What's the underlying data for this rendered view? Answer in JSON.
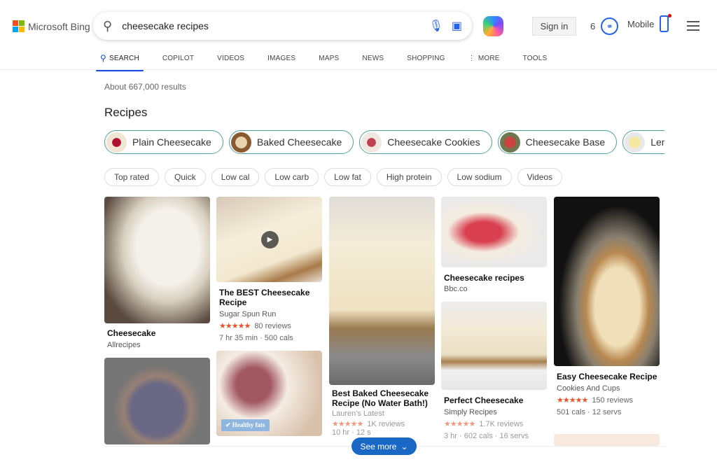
{
  "header": {
    "logo": "Microsoft Bing",
    "query": "cheesecake recipes",
    "sign_in": "Sign in",
    "rewards_count": "6",
    "mobile": "Mobile"
  },
  "tabs": [
    {
      "label": "SEARCH",
      "active": true
    },
    {
      "label": "COPILOT"
    },
    {
      "label": "VIDEOS"
    },
    {
      "label": "IMAGES"
    },
    {
      "label": "MAPS"
    },
    {
      "label": "NEWS"
    },
    {
      "label": "SHOPPING"
    },
    {
      "label": "MORE"
    },
    {
      "label": "TOOLS"
    }
  ],
  "results_count": "About 667,000 results",
  "section_title": "Recipes",
  "chips": [
    "Plain Cheesecake",
    "Baked Cheesecake",
    "Cheesecake Cookies",
    "Cheesecake Base",
    "Lemon Cheesecake"
  ],
  "filters": [
    "Top rated",
    "Quick",
    "Low cal",
    "Low carb",
    "Low fat",
    "High protein",
    "Low sodium",
    "Videos"
  ],
  "cards": [
    {
      "title": "Cheesecake",
      "source": "Allrecipes"
    },
    {
      "title": "The BEST Cheesecake Recipe",
      "source": "Sugar Spun Run",
      "stars": "★★★★★",
      "reviews": "80 reviews",
      "meta": "7 hr 35 min · 500 cals",
      "video": true
    },
    {
      "title": "Best Baked Cheesecake Recipe (No Water Bath!)",
      "source": "Lauren's Latest",
      "stars": "★★★★★",
      "reviews": "1K reviews",
      "meta": "10 hr · 12 s"
    },
    {
      "title": "Cheesecake recipes",
      "source": "Bbc.co"
    },
    {
      "title": "Perfect Cheesecake",
      "source": "Simply Recipes",
      "stars": "★★★★★",
      "reviews": "1.7K reviews",
      "meta": "3 hr · 602 cals · 16 servs"
    },
    {
      "title": "Easy Cheesecake Recipe",
      "source": "Cookies And Cups",
      "stars": "★★★★★",
      "reviews": "150 reviews",
      "meta": "501 cals · 12 servs"
    }
  ],
  "badge": "Healthy fats",
  "see_more": "See more",
  "colors": {
    "accent": "#174ae4",
    "see_more": "#1a68c6",
    "stars": "#e8552a",
    "chip_border": "#4f9f9f"
  }
}
